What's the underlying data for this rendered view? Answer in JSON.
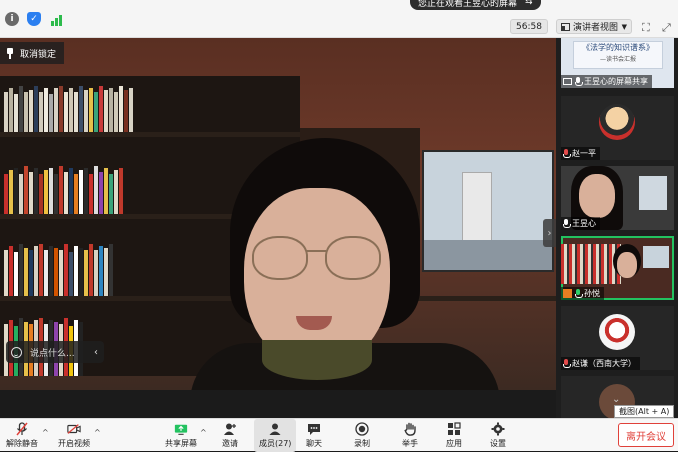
{
  "header": {
    "viewing_text": "您正在观看王昱心的屏幕",
    "timer": "56:58",
    "view_button_label": "演讲者视图"
  },
  "main": {
    "unlock_label": "取消锁定",
    "chat_placeholder": "说点什么..."
  },
  "gallery": {
    "tiles": [
      {
        "name": "王昱心的屏幕共享",
        "share_text": "《法学的知识谱系》",
        "share_sub": "—读书会汇报"
      },
      {
        "name": "赵一平"
      },
      {
        "name": "王昱心"
      },
      {
        "name": "孙悦"
      },
      {
        "name": "赵谦（西南大学）"
      },
      {
        "name": ""
      }
    ]
  },
  "toolbar": {
    "unmute": "解除静音",
    "start_video": "开启视频",
    "share_screen": "共享屏幕",
    "invite": "邀请",
    "members": "成员(27)",
    "chat": "聊天",
    "record": "录制",
    "raise_hand": "举手",
    "apps": "应用",
    "settings": "设置",
    "leave": "离开会议",
    "tooltip": "截图(Alt + A)"
  },
  "colors": {
    "accent_green": "#23c260",
    "leave_red": "#e0413a",
    "shield_blue": "#2b7ff0"
  }
}
